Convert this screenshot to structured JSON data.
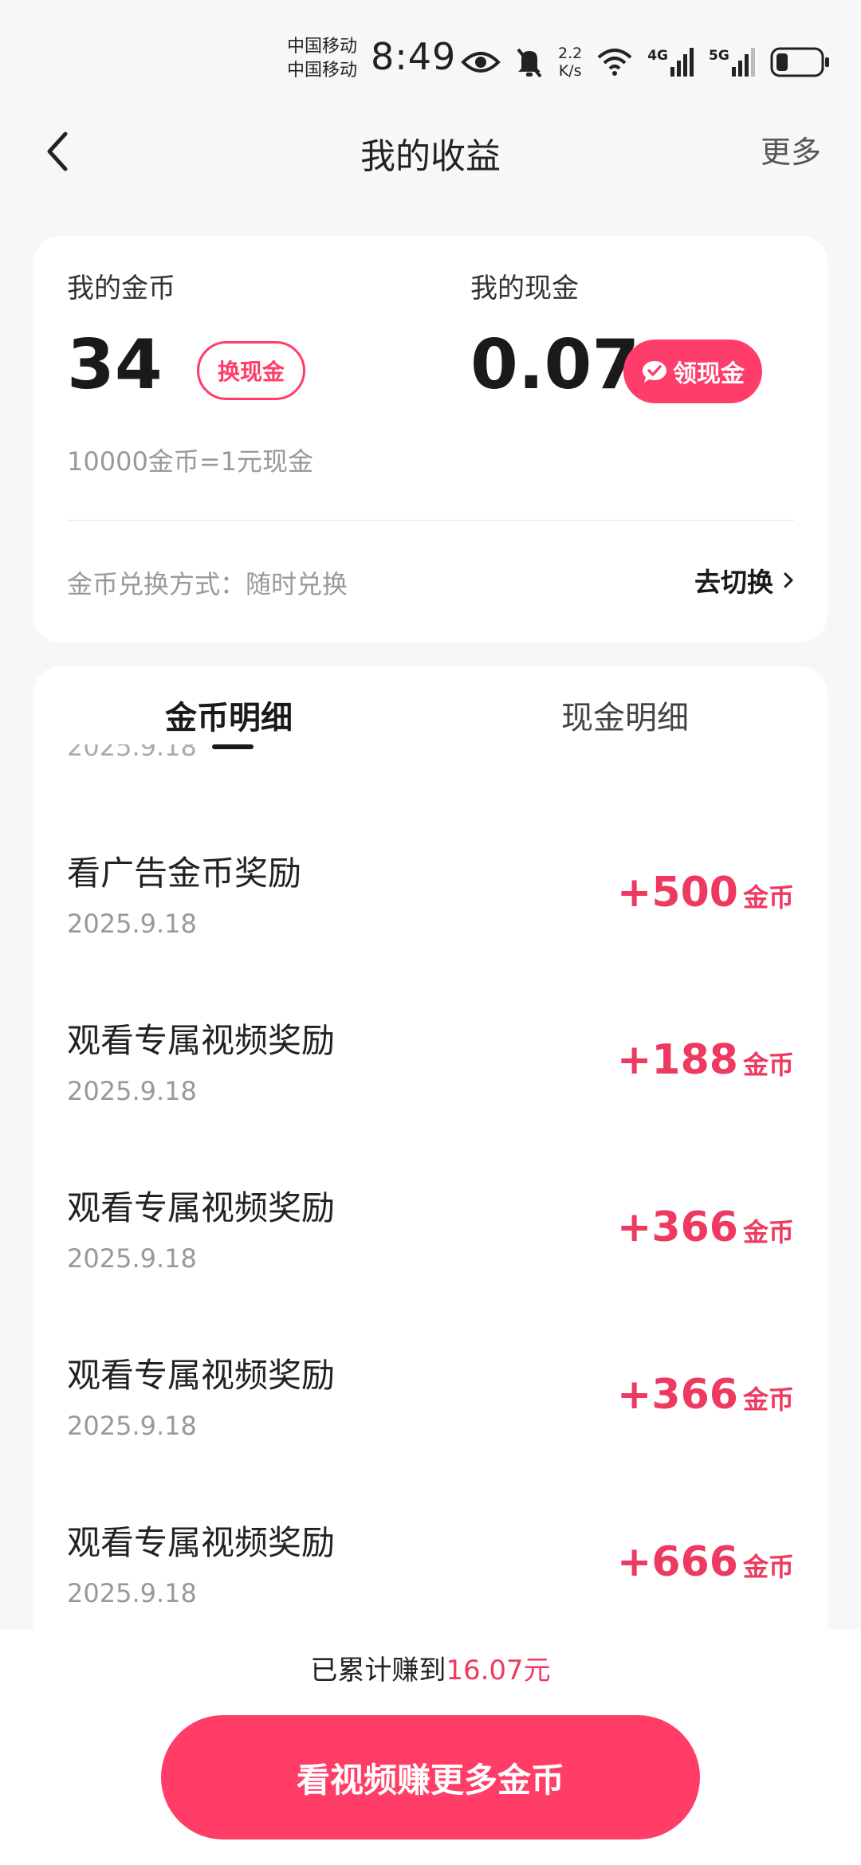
{
  "status_bar": {
    "carrier_1": "中国移动",
    "carrier_2": "中国移动",
    "time": "8:49",
    "speed_value": "2.2",
    "speed_unit": "K/s",
    "net_1": "4G",
    "net_2": "5G"
  },
  "header": {
    "title": "我的收益",
    "more": "更多"
  },
  "summary": {
    "coins_label": "我的金币",
    "coins_value": "34",
    "exchange_button": "换现金",
    "cash_label": "我的现金",
    "cash_value": "0.07",
    "claim_button": "领现金",
    "rate_text": "10000金币=1元现金",
    "method_text": "金币兑换方式：随时兑换",
    "switch_text": "去切换"
  },
  "tabs": {
    "coin_detail": "金币明细",
    "cash_detail": "现金明细"
  },
  "cut_date": "2025.9.18",
  "records": [
    {
      "title": "看广告金币奖励",
      "date": "2025.9.18",
      "amount": "+500",
      "unit": "金币"
    },
    {
      "title": "观看专属视频奖励",
      "date": "2025.9.18",
      "amount": "+188",
      "unit": "金币"
    },
    {
      "title": "观看专属视频奖励",
      "date": "2025.9.18",
      "amount": "+366",
      "unit": "金币"
    },
    {
      "title": "观看专属视频奖励",
      "date": "2025.9.18",
      "amount": "+366",
      "unit": "金币"
    },
    {
      "title": "观看专属视频奖励",
      "date": "2025.9.18",
      "amount": "+666",
      "unit": "金币"
    }
  ],
  "footer": {
    "total_prefix": "已累计赚到",
    "total_value": "16.07元",
    "cta": "看视频赚更多金币"
  },
  "colors": {
    "accent": "#ff3d6a",
    "amount": "#ee3a60"
  }
}
